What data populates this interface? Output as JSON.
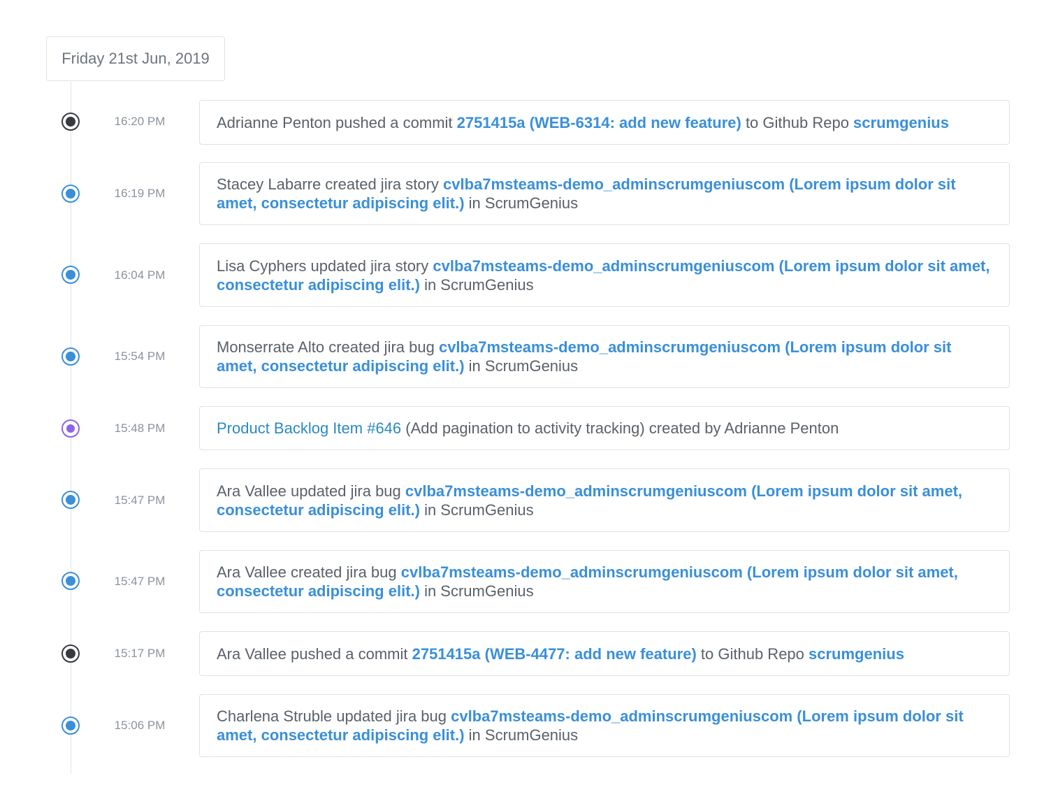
{
  "date_header": "Friday 21st Jun, 2019",
  "colors": {
    "link": "#3a8fd9",
    "commit_dot": "#343a40",
    "jira_dot": "#3a8fd9",
    "backlog_dot": "#8f63e8"
  },
  "events": [
    {
      "time": "16:20 PM",
      "icon": "commit-dot-icon",
      "p1": "Adrianne Penton pushed a commit ",
      "l1": "2751415a (WEB-6314: add new feature)",
      "p2": " to Github Repo ",
      "l2": "scrumgenius",
      "p3": ""
    },
    {
      "time": "16:19 PM",
      "icon": "jira-dot-icon",
      "p1": "Stacey Labarre created jira story ",
      "l1": "cvlba7msteams-demo_adminscrumgeniuscom (Lorem ipsum dolor sit amet, consectetur adipiscing elit.)",
      "p2": " in ScrumGenius",
      "l2": "",
      "p3": ""
    },
    {
      "time": "16:04 PM",
      "icon": "jira-dot-icon",
      "p1": "Lisa Cyphers updated jira story ",
      "l1": "cvlba7msteams-demo_adminscrumgeniuscom (Lorem ipsum dolor sit amet, consectetur adipiscing elit.)",
      "p2": " in ScrumGenius",
      "l2": "",
      "p3": ""
    },
    {
      "time": "15:54 PM",
      "icon": "jira-dot-icon",
      "p1": "Monserrate Alto created jira bug ",
      "l1": "cvlba7msteams-demo_adminscrumgeniuscom (Lorem ipsum dolor sit amet, consectetur adipiscing elit.)",
      "p2": " in ScrumGenius",
      "l2": "",
      "p3": ""
    },
    {
      "time": "15:48 PM",
      "icon": "backlog-dot-icon",
      "l0": "Product Backlog Item #646",
      "p1": " (Add pagination to activity tracking) created by Adrianne Penton"
    },
    {
      "time": "15:47 PM",
      "icon": "jira-dot-icon",
      "p1": "Ara Vallee updated jira bug ",
      "l1": "cvlba7msteams-demo_adminscrumgeniuscom (Lorem ipsum dolor sit amet, consectetur adipiscing elit.)",
      "p2": " in ScrumGenius",
      "l2": "",
      "p3": ""
    },
    {
      "time": "15:47 PM",
      "icon": "jira-dot-icon",
      "p1": "Ara Vallee created jira bug ",
      "l1": "cvlba7msteams-demo_adminscrumgeniuscom (Lorem ipsum dolor sit amet, consectetur adipiscing elit.)",
      "p2": " in ScrumGenius",
      "l2": "",
      "p3": ""
    },
    {
      "time": "15:17 PM",
      "icon": "commit-dot-icon",
      "p1": "Ara Vallee pushed a commit ",
      "l1": "2751415a (WEB-4477: add new feature)",
      "p2": " to Github Repo ",
      "l2": "scrumgenius",
      "p3": ""
    },
    {
      "time": "15:06 PM",
      "icon": "jira-dot-icon",
      "p1": "Charlena Struble updated jira bug ",
      "l1": "cvlba7msteams-demo_adminscrumgeniuscom (Lorem ipsum dolor sit amet, consectetur adipiscing elit.)",
      "p2": " in ScrumGenius",
      "l2": "",
      "p3": ""
    }
  ]
}
